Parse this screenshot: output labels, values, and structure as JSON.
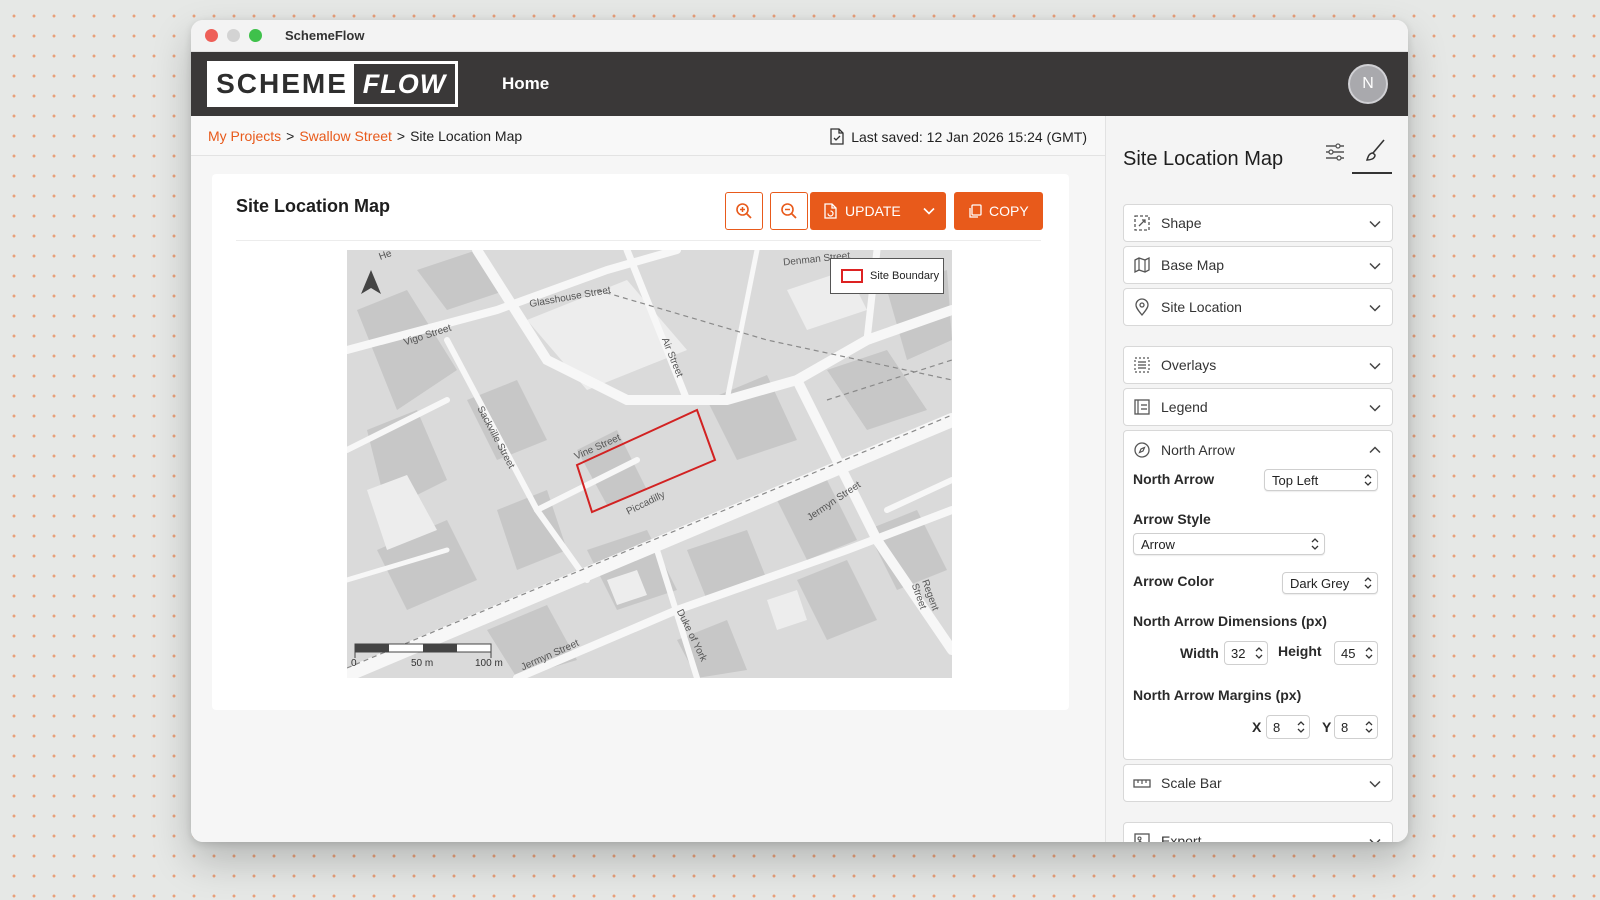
{
  "window": {
    "title": "SchemeFlow"
  },
  "nav": {
    "logo_left": "SCHEME",
    "logo_right": "FLOW",
    "home": "Home",
    "avatar_initial": "N"
  },
  "breadcrumb": {
    "items": [
      "My Projects",
      "Swallow Street",
      "Site Location Map"
    ],
    "sep": ">",
    "last_saved": "Last saved: 12 Jan 2026 15:24 (GMT)"
  },
  "card": {
    "title": "Site Location Map",
    "update_label": "UPDATE",
    "copy_label": "COPY"
  },
  "map": {
    "legend_label": "Site Boundary",
    "boundary_color": "#d22222",
    "scale": {
      "start": "0",
      "mid": "50 m",
      "end": "100 m"
    },
    "streets": [
      "Glasshouse Street",
      "Vigo Street",
      "Air Street",
      "Sackville Street",
      "Vine Street",
      "Piccadilly",
      "Jermyn Street",
      "Jermyn Street",
      "Duke of York",
      "Regent Street",
      "Denman Street",
      "He"
    ]
  },
  "panel": {
    "title": "Site Location Map",
    "sections": {
      "shape": "Shape",
      "base_map": "Base Map",
      "site_location": "Site Location",
      "overlays": "Overlays",
      "legend": "Legend",
      "north_arrow": "North Arrow",
      "scale_bar": "Scale Bar",
      "export": "Export"
    },
    "north_arrow": {
      "position_label": "North Arrow",
      "position_value": "Top Left",
      "style_label": "Arrow Style",
      "style_value": "Arrow",
      "color_label": "Arrow Color",
      "color_value": "Dark Grey",
      "dims_label": "North Arrow Dimensions (px)",
      "width_label": "Width",
      "width_value": "32",
      "height_label": "Height",
      "height_value": "45",
      "margins_label": "North Arrow Margins (px)",
      "x_label": "X",
      "x_value": "8",
      "y_label": "Y",
      "y_value": "8"
    }
  },
  "colors": {
    "accent": "#e85a1b",
    "nav_bg": "#3a3838"
  }
}
